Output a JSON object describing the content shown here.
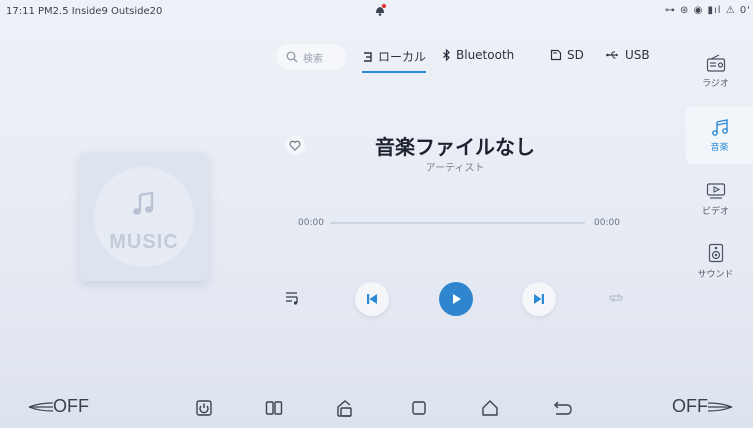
{
  "status": {
    "left_text": "17:11 PM2.5 Inside9 Outside20",
    "right_text": "⊶ ⊛ ◉ ▮ıl ⚠ 0'"
  },
  "tabs": {
    "search_placeholder": "検索",
    "items": [
      {
        "label": "ローカル",
        "icon": "local-music-icon",
        "active": true
      },
      {
        "label": "Bluetooth",
        "icon": "bluetooth-icon",
        "active": false
      },
      {
        "label": "SD",
        "icon": "sd-card-icon",
        "active": false
      },
      {
        "label": "USB",
        "icon": "usb-icon",
        "active": false
      }
    ]
  },
  "album": {
    "label": "MUSIC"
  },
  "track": {
    "title": "音楽ファイルなし",
    "artist": "アーティスト",
    "time_current": "00:00",
    "time_total": "00:00",
    "progress": 0
  },
  "sidebar": {
    "items": [
      {
        "label": "ラジオ",
        "icon": "radio-icon",
        "active": false
      },
      {
        "label": "音楽",
        "icon": "music-note-icon",
        "active": true
      },
      {
        "label": "ビデオ",
        "icon": "video-icon",
        "active": false
      },
      {
        "label": "サウンド",
        "icon": "speaker-icon",
        "active": false
      }
    ]
  },
  "bottom": {
    "left_temp": "OFF",
    "right_temp": "OFF"
  },
  "colors": {
    "accent": "#2d8ad6",
    "play": "#2f86cf",
    "background": "#e6eaf3"
  }
}
